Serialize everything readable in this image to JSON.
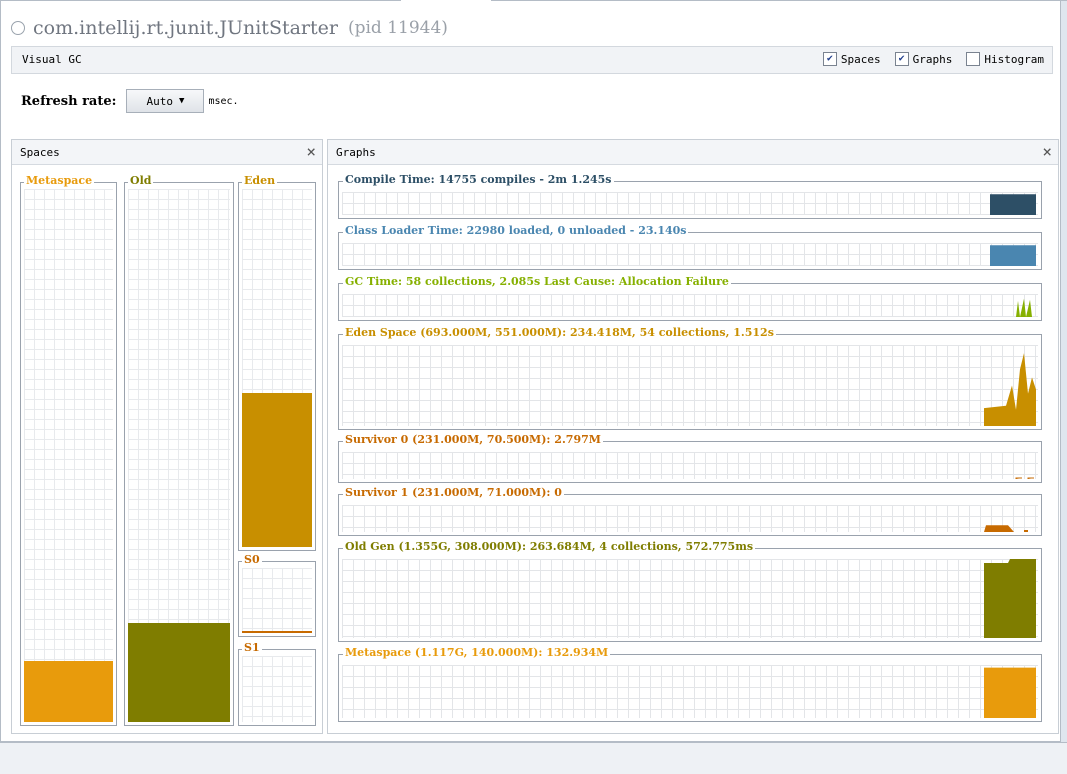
{
  "title": {
    "main": "com.intellij.rt.junit.JUnitStarter",
    "pid": "(pid 11944)"
  },
  "visual_gc": {
    "label": "Visual GC",
    "checks": [
      {
        "label": "Spaces",
        "checked": true
      },
      {
        "label": "Graphs",
        "checked": true
      },
      {
        "label": "Histogram",
        "checked": false
      }
    ]
  },
  "refresh": {
    "label": "Refresh rate:",
    "value": "Auto",
    "unit": "msec."
  },
  "spaces_panel": {
    "title": "Spaces",
    "close": "×",
    "spaces": [
      {
        "label": "Metaspace",
        "color": "#e89b0c",
        "fill_fraction": 0.115
      },
      {
        "label": "Old",
        "color": "#7f7d00",
        "fill_fraction": 0.185
      },
      {
        "label": "Eden",
        "color": "#c88f00",
        "fill_fraction": 0.43
      },
      {
        "label": "S0",
        "color": "#c76a00",
        "fill_fraction": 0.03
      },
      {
        "label": "S1",
        "color": "#c76a00",
        "fill_fraction": 0.0
      }
    ]
  },
  "graphs_panel": {
    "title": "Graphs",
    "close": "×",
    "graphs": [
      {
        "label": "Compile Time: 14755 compiles - 2m 1.245s",
        "color": "#2d4f66"
      },
      {
        "label": "Class Loader Time: 22980 loaded, 0 unloaded - 23.140s",
        "color": "#4a86b0"
      },
      {
        "label": "GC Time: 58 collections, 2.085s  Last Cause: Allocation Failure",
        "color": "#86b000"
      },
      {
        "label": "Eden Space (693.000M, 551.000M): 234.418M, 54 collections, 1.512s",
        "color": "#c88f00"
      },
      {
        "label": "Survivor 0 (231.000M, 70.500M): 2.797M",
        "color": "#c76a00"
      },
      {
        "label": "Survivor 1 (231.000M, 71.000M): 0",
        "color": "#c76a00"
      },
      {
        "label": "Old Gen (1.355G, 308.000M): 263.684M, 4 collections, 572.775ms",
        "color": "#7f7d00"
      },
      {
        "label": "Metaspace (1.117G, 140.000M): 132.934M",
        "color": "#e89b0c"
      }
    ]
  }
}
